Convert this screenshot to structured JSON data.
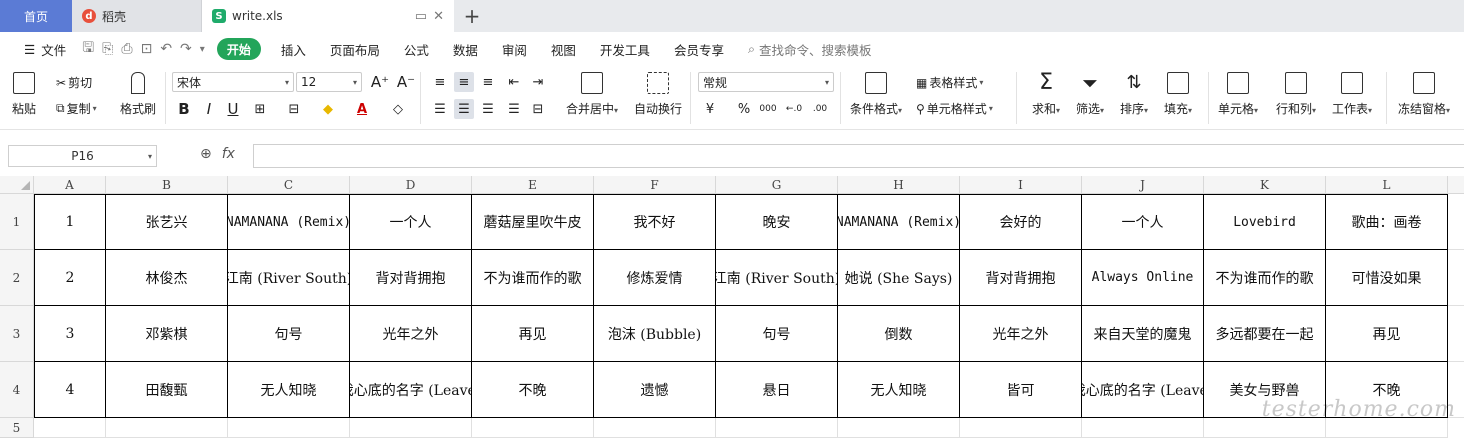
{
  "tabs": {
    "home": "首页",
    "docer": "稻壳",
    "file": "write.xls"
  },
  "menu": {
    "file": "文件",
    "items": [
      "开始",
      "插入",
      "页面布局",
      "公式",
      "数据",
      "审阅",
      "视图",
      "开发工具",
      "会员专享"
    ],
    "search": "查找命令、搜索模板"
  },
  "ribbon": {
    "paste": "粘贴",
    "cut": "剪切",
    "copy": "复制",
    "format_painter": "格式刷",
    "font": "宋体",
    "font_size": "12",
    "merge_center": "合并居中",
    "wrap": "自动换行",
    "number_format": "常规",
    "cond_format": "条件格式",
    "table_style": "表格样式",
    "cell_style": "单元格样式",
    "sum": "求和",
    "filter": "筛选",
    "sort": "排序",
    "fill": "填充",
    "cells": "单元格",
    "row_col": "行和列",
    "sheet": "工作表",
    "freeze": "冻结窗格",
    "bold": "B",
    "italic": "I",
    "underline": "U",
    "currency": "¥",
    "percent": "%",
    "thousands": "000",
    "dec_inc": "←.0",
    "dec_dec": ".00"
  },
  "formula_bar": {
    "name_box": "P16",
    "fx": "fx",
    "content": ""
  },
  "columns": [
    "A",
    "B",
    "C",
    "D",
    "E",
    "F",
    "G",
    "H",
    "I",
    "J",
    "K",
    "L"
  ],
  "rows": [
    [
      "1",
      "张艺兴",
      "NAMANANA (Remix)",
      "一个人",
      "蘑菇屋里吹牛皮",
      "我不好",
      "晚安",
      "NAMANANA (Remix)",
      "会好的",
      "一个人",
      "Lovebird",
      "歌曲：画卷"
    ],
    [
      "2",
      "林俊杰",
      "江南 (River South)",
      "背对背拥抱",
      "不为谁而作的歌",
      "修炼爱情",
      "江南 (River South)",
      "她说 (She Says)",
      "背对背拥抱",
      "Always Online",
      "不为谁而作的歌",
      "可惜没如果"
    ],
    [
      "3",
      "邓紫棋",
      "句号",
      "光年之外",
      "再见",
      "泡沫 (Bubble)",
      "句号",
      "倒数",
      "光年之外",
      "来自天堂的魔鬼",
      "多远都要在一起",
      "再见"
    ],
    [
      "4",
      "田馥甄",
      "无人知晓",
      "我心底的名字 (Leave)",
      "不晚",
      "遗憾",
      "悬日",
      "无人知晓",
      "皆可",
      "我心底的名字 (Leave)",
      "美女与野兽",
      "不晚"
    ]
  ],
  "row_headers": [
    "1",
    "2",
    "3",
    "4",
    "5"
  ],
  "watermark": "testerhome.com"
}
